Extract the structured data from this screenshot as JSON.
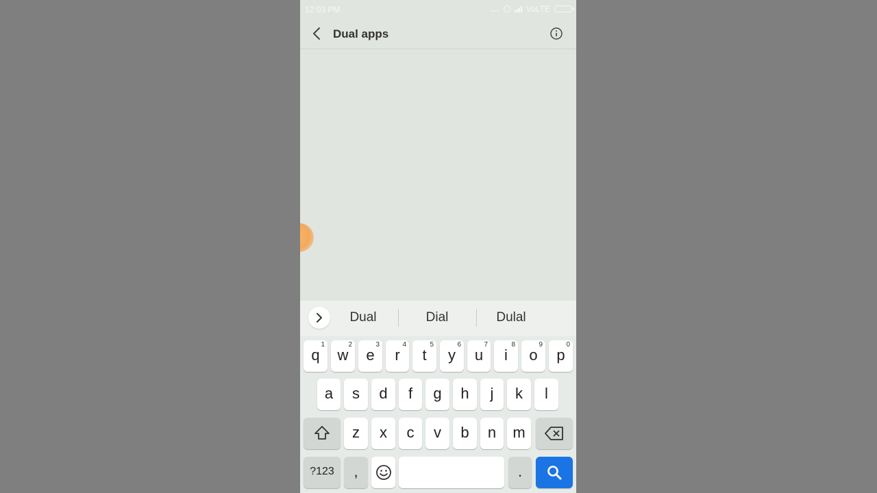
{
  "status_bar": {
    "time": "12:03 PM",
    "dots": "...",
    "network": "VoLTE"
  },
  "title_bar": {
    "title": "Dual apps"
  },
  "keyboard": {
    "suggestions": [
      "Dual",
      "Dial",
      "Dulal"
    ],
    "row1": [
      {
        "key": "q",
        "sub": "1"
      },
      {
        "key": "w",
        "sub": "2"
      },
      {
        "key": "e",
        "sub": "3"
      },
      {
        "key": "r",
        "sub": "4"
      },
      {
        "key": "t",
        "sub": "5"
      },
      {
        "key": "y",
        "sub": "6"
      },
      {
        "key": "u",
        "sub": "7"
      },
      {
        "key": "i",
        "sub": "8"
      },
      {
        "key": "o",
        "sub": "9"
      },
      {
        "key": "p",
        "sub": "0"
      }
    ],
    "row2": [
      "a",
      "s",
      "d",
      "f",
      "g",
      "h",
      "j",
      "k",
      "l"
    ],
    "row3": [
      "z",
      "x",
      "c",
      "v",
      "b",
      "n",
      "m"
    ],
    "symbols_label": "?123",
    "comma": ",",
    "period": ".",
    "icons": {
      "shift": "shift-icon",
      "backspace": "backspace-icon",
      "emoji": "emoji-icon",
      "search": "search-icon",
      "expand": "chevron-right-icon"
    }
  },
  "colors": {
    "accent": "#1b74e4",
    "screen_background": "#e1e5e0",
    "outer_background": "#808080"
  }
}
